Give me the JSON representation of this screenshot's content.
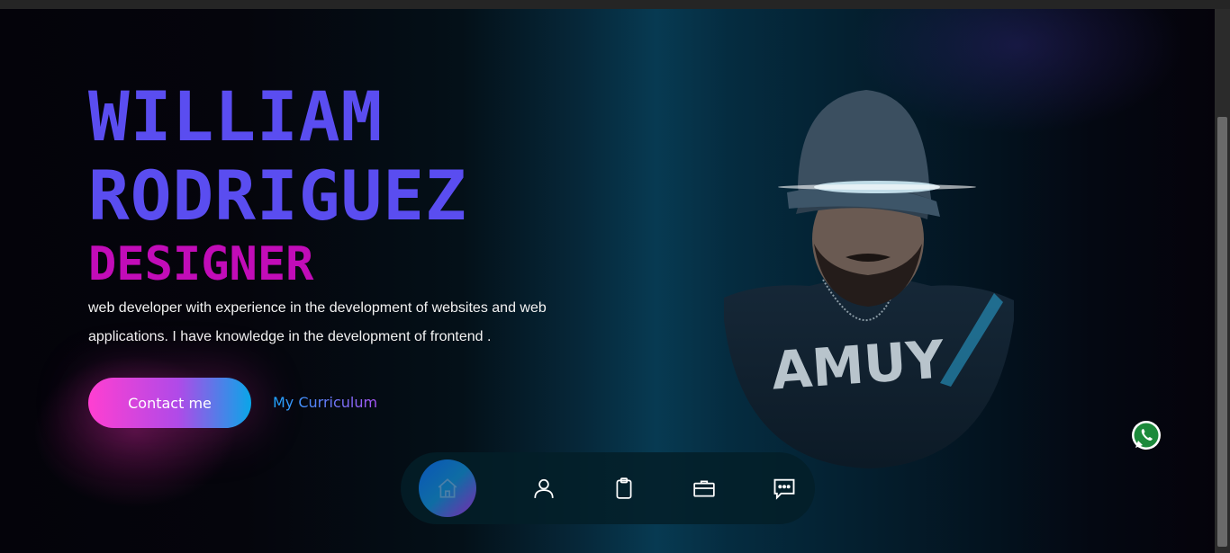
{
  "hero": {
    "name_line1": "WILLIAM",
    "name_line2": "RODRIGUEZ",
    "role": "DESIGNER",
    "bio": "web developer with experience in the development of websites and web applications. I have knowledge in the development of frontend ."
  },
  "actions": {
    "contact_label": "Contact me",
    "curriculum_label": "My Curriculum"
  },
  "nav": {
    "items": [
      {
        "icon": "home-icon",
        "active": true
      },
      {
        "icon": "user-icon",
        "active": false
      },
      {
        "icon": "clipboard-icon",
        "active": false
      },
      {
        "icon": "briefcase-icon",
        "active": false
      },
      {
        "icon": "chat-icon",
        "active": false
      }
    ]
  },
  "floating": {
    "icon": "whatsapp-icon"
  },
  "colors": {
    "name": "#5a4df0",
    "role": "#c20cb8",
    "accent_pink": "#ff3fd1",
    "accent_blue": "#0aa6e8",
    "whatsapp": "#1c8a3b"
  }
}
